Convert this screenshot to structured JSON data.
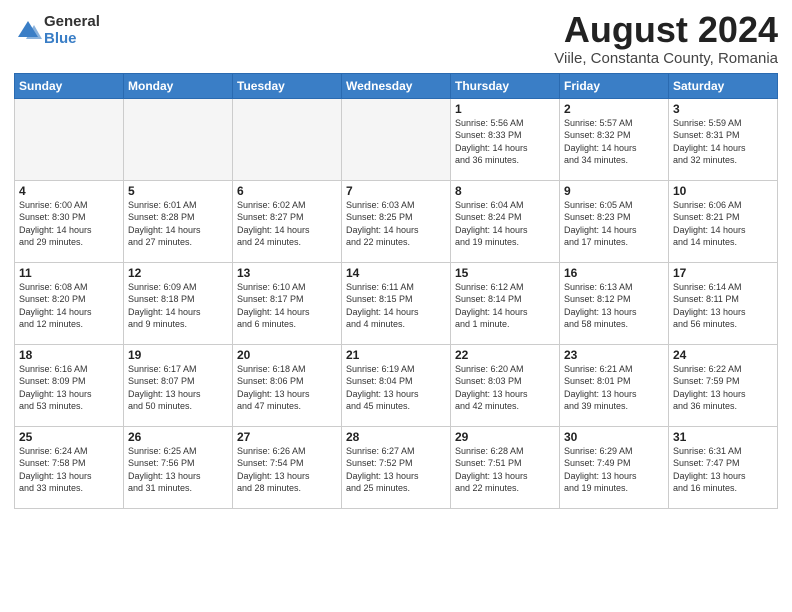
{
  "logo": {
    "general": "General",
    "blue": "Blue"
  },
  "title": "August 2024",
  "subtitle": "Viile, Constanta County, Romania",
  "weekdays": [
    "Sunday",
    "Monday",
    "Tuesday",
    "Wednesday",
    "Thursday",
    "Friday",
    "Saturday"
  ],
  "weeks": [
    [
      {
        "day": "",
        "info": ""
      },
      {
        "day": "",
        "info": ""
      },
      {
        "day": "",
        "info": ""
      },
      {
        "day": "",
        "info": ""
      },
      {
        "day": "1",
        "info": "Sunrise: 5:56 AM\nSunset: 8:33 PM\nDaylight: 14 hours\nand 36 minutes."
      },
      {
        "day": "2",
        "info": "Sunrise: 5:57 AM\nSunset: 8:32 PM\nDaylight: 14 hours\nand 34 minutes."
      },
      {
        "day": "3",
        "info": "Sunrise: 5:59 AM\nSunset: 8:31 PM\nDaylight: 14 hours\nand 32 minutes."
      }
    ],
    [
      {
        "day": "4",
        "info": "Sunrise: 6:00 AM\nSunset: 8:30 PM\nDaylight: 14 hours\nand 29 minutes."
      },
      {
        "day": "5",
        "info": "Sunrise: 6:01 AM\nSunset: 8:28 PM\nDaylight: 14 hours\nand 27 minutes."
      },
      {
        "day": "6",
        "info": "Sunrise: 6:02 AM\nSunset: 8:27 PM\nDaylight: 14 hours\nand 24 minutes."
      },
      {
        "day": "7",
        "info": "Sunrise: 6:03 AM\nSunset: 8:25 PM\nDaylight: 14 hours\nand 22 minutes."
      },
      {
        "day": "8",
        "info": "Sunrise: 6:04 AM\nSunset: 8:24 PM\nDaylight: 14 hours\nand 19 minutes."
      },
      {
        "day": "9",
        "info": "Sunrise: 6:05 AM\nSunset: 8:23 PM\nDaylight: 14 hours\nand 17 minutes."
      },
      {
        "day": "10",
        "info": "Sunrise: 6:06 AM\nSunset: 8:21 PM\nDaylight: 14 hours\nand 14 minutes."
      }
    ],
    [
      {
        "day": "11",
        "info": "Sunrise: 6:08 AM\nSunset: 8:20 PM\nDaylight: 14 hours\nand 12 minutes."
      },
      {
        "day": "12",
        "info": "Sunrise: 6:09 AM\nSunset: 8:18 PM\nDaylight: 14 hours\nand 9 minutes."
      },
      {
        "day": "13",
        "info": "Sunrise: 6:10 AM\nSunset: 8:17 PM\nDaylight: 14 hours\nand 6 minutes."
      },
      {
        "day": "14",
        "info": "Sunrise: 6:11 AM\nSunset: 8:15 PM\nDaylight: 14 hours\nand 4 minutes."
      },
      {
        "day": "15",
        "info": "Sunrise: 6:12 AM\nSunset: 8:14 PM\nDaylight: 14 hours\nand 1 minute."
      },
      {
        "day": "16",
        "info": "Sunrise: 6:13 AM\nSunset: 8:12 PM\nDaylight: 13 hours\nand 58 minutes."
      },
      {
        "day": "17",
        "info": "Sunrise: 6:14 AM\nSunset: 8:11 PM\nDaylight: 13 hours\nand 56 minutes."
      }
    ],
    [
      {
        "day": "18",
        "info": "Sunrise: 6:16 AM\nSunset: 8:09 PM\nDaylight: 13 hours\nand 53 minutes."
      },
      {
        "day": "19",
        "info": "Sunrise: 6:17 AM\nSunset: 8:07 PM\nDaylight: 13 hours\nand 50 minutes."
      },
      {
        "day": "20",
        "info": "Sunrise: 6:18 AM\nSunset: 8:06 PM\nDaylight: 13 hours\nand 47 minutes."
      },
      {
        "day": "21",
        "info": "Sunrise: 6:19 AM\nSunset: 8:04 PM\nDaylight: 13 hours\nand 45 minutes."
      },
      {
        "day": "22",
        "info": "Sunrise: 6:20 AM\nSunset: 8:03 PM\nDaylight: 13 hours\nand 42 minutes."
      },
      {
        "day": "23",
        "info": "Sunrise: 6:21 AM\nSunset: 8:01 PM\nDaylight: 13 hours\nand 39 minutes."
      },
      {
        "day": "24",
        "info": "Sunrise: 6:22 AM\nSunset: 7:59 PM\nDaylight: 13 hours\nand 36 minutes."
      }
    ],
    [
      {
        "day": "25",
        "info": "Sunrise: 6:24 AM\nSunset: 7:58 PM\nDaylight: 13 hours\nand 33 minutes."
      },
      {
        "day": "26",
        "info": "Sunrise: 6:25 AM\nSunset: 7:56 PM\nDaylight: 13 hours\nand 31 minutes."
      },
      {
        "day": "27",
        "info": "Sunrise: 6:26 AM\nSunset: 7:54 PM\nDaylight: 13 hours\nand 28 minutes."
      },
      {
        "day": "28",
        "info": "Sunrise: 6:27 AM\nSunset: 7:52 PM\nDaylight: 13 hours\nand 25 minutes."
      },
      {
        "day": "29",
        "info": "Sunrise: 6:28 AM\nSunset: 7:51 PM\nDaylight: 13 hours\nand 22 minutes."
      },
      {
        "day": "30",
        "info": "Sunrise: 6:29 AM\nSunset: 7:49 PM\nDaylight: 13 hours\nand 19 minutes."
      },
      {
        "day": "31",
        "info": "Sunrise: 6:31 AM\nSunset: 7:47 PM\nDaylight: 13 hours\nand 16 minutes."
      }
    ]
  ]
}
